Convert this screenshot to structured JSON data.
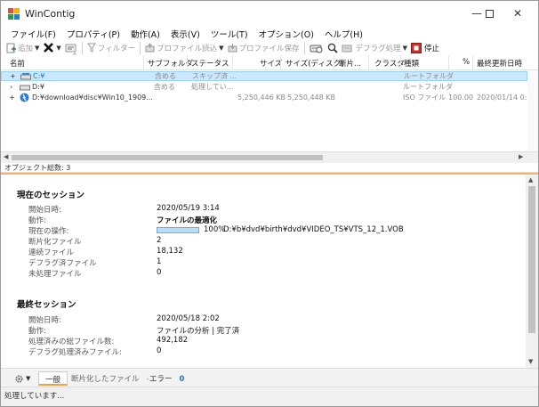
{
  "window": {
    "title": "WinContig"
  },
  "menu": [
    "ファイル(F)",
    "プロパティ(P)",
    "動作(A)",
    "表示(V)",
    "ツール(T)",
    "オプション(O)",
    "ヘルプ(H)"
  ],
  "toolbar": {
    "add": "追加",
    "filter": "フィルター",
    "profile_load": "プロファイル読込",
    "profile_save": "プロファイル保存",
    "defrag": "デフラグ処理",
    "stop": "停止"
  },
  "columns": [
    "名前",
    "サブフォルダ",
    "ステータス",
    "サイズ",
    "サイズ(ディスク)",
    "断片...",
    "クラスタ",
    "種類",
    "%",
    "最終更新日時"
  ],
  "rows": [
    {
      "name": "C:¥",
      "subfolder": "含める",
      "status": "スキップ済 ...",
      "size": "",
      "disk_size": "",
      "type": "ルートフォルダ",
      "percent": "",
      "modified": ""
    },
    {
      "name": "D:¥",
      "subfolder": "含める",
      "status": "処理してい...",
      "size": "",
      "disk_size": "",
      "type": "ルートフォルダ",
      "percent": "",
      "modified": ""
    },
    {
      "name": "D:¥download¥disc¥Win10_1909...",
      "subfolder": "",
      "status": "",
      "size": "5,250,446 KB",
      "disk_size": "5,250,448 KB",
      "type": "ISO ファイル",
      "percent": "100.00",
      "modified": "2020/01/14 0:43"
    }
  ],
  "object_count": "オブジェクト総数: 3",
  "current_session": {
    "title": "現在のセッション",
    "start_label": "開始日時:",
    "start_value": "2020/05/19 3:14",
    "action_label": "動作:",
    "action_value": "ファイルの最適化",
    "op_label": "現在の操作:",
    "progress_percent": 100,
    "progress_text": "100%",
    "op_path": "D:¥b¥dvd¥birth¥dvd¥VIDEO_TS¥VTS_12_1.VOB",
    "frag_label": "断片化ファイル",
    "frag_value": "2",
    "contig_label": "連続ファイル",
    "contig_value": "18,132",
    "defragged_label": "デフラグ済ファイル",
    "defragged_value": "1",
    "unprocessed_label": "未処理ファイル",
    "unprocessed_value": "0"
  },
  "last_session": {
    "title": "最終セッション",
    "start_label": "開始日時:",
    "start_value": "2020/05/18 2:02",
    "action_label": "動作:",
    "action_value": "ファイルの分析 | 完了済",
    "processed_label": "処理済みの総ファイル数:",
    "processed_value": "492,182",
    "defrag_label": "デフラグ処理済みファイル:",
    "defrag_value": "0"
  },
  "tabs": {
    "general": "一般",
    "fragmented": "断片化したファイル",
    "fragmented_count": "-",
    "errors": "エラー",
    "errors_count": "0"
  },
  "status": "処理しています..."
}
